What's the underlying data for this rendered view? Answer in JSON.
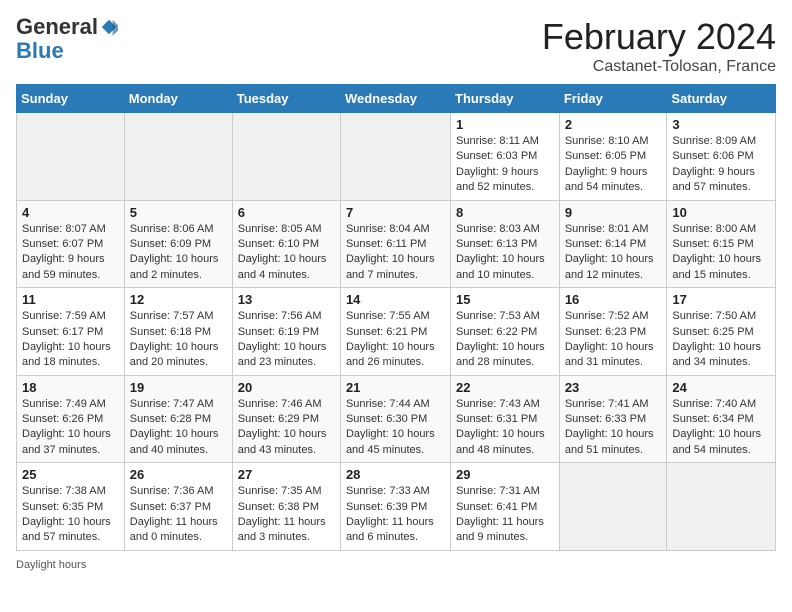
{
  "header": {
    "logo_general": "General",
    "logo_blue": "Blue",
    "main_title": "February 2024",
    "subtitle": "Castanet-Tolosan, France"
  },
  "days_of_week": [
    "Sunday",
    "Monday",
    "Tuesday",
    "Wednesday",
    "Thursday",
    "Friday",
    "Saturday"
  ],
  "footer": {
    "note": "Daylight hours"
  },
  "weeks": [
    {
      "days": [
        {
          "number": "",
          "info": "",
          "empty": true
        },
        {
          "number": "",
          "info": "",
          "empty": true
        },
        {
          "number": "",
          "info": "",
          "empty": true
        },
        {
          "number": "",
          "info": "",
          "empty": true
        },
        {
          "number": "1",
          "info": "Sunrise: 8:11 AM\nSunset: 6:03 PM\nDaylight: 9 hours and 52 minutes."
        },
        {
          "number": "2",
          "info": "Sunrise: 8:10 AM\nSunset: 6:05 PM\nDaylight: 9 hours and 54 minutes."
        },
        {
          "number": "3",
          "info": "Sunrise: 8:09 AM\nSunset: 6:06 PM\nDaylight: 9 hours and 57 minutes."
        }
      ]
    },
    {
      "days": [
        {
          "number": "4",
          "info": "Sunrise: 8:07 AM\nSunset: 6:07 PM\nDaylight: 9 hours and 59 minutes."
        },
        {
          "number": "5",
          "info": "Sunrise: 8:06 AM\nSunset: 6:09 PM\nDaylight: 10 hours and 2 minutes."
        },
        {
          "number": "6",
          "info": "Sunrise: 8:05 AM\nSunset: 6:10 PM\nDaylight: 10 hours and 4 minutes."
        },
        {
          "number": "7",
          "info": "Sunrise: 8:04 AM\nSunset: 6:11 PM\nDaylight: 10 hours and 7 minutes."
        },
        {
          "number": "8",
          "info": "Sunrise: 8:03 AM\nSunset: 6:13 PM\nDaylight: 10 hours and 10 minutes."
        },
        {
          "number": "9",
          "info": "Sunrise: 8:01 AM\nSunset: 6:14 PM\nDaylight: 10 hours and 12 minutes."
        },
        {
          "number": "10",
          "info": "Sunrise: 8:00 AM\nSunset: 6:15 PM\nDaylight: 10 hours and 15 minutes."
        }
      ]
    },
    {
      "days": [
        {
          "number": "11",
          "info": "Sunrise: 7:59 AM\nSunset: 6:17 PM\nDaylight: 10 hours and 18 minutes."
        },
        {
          "number": "12",
          "info": "Sunrise: 7:57 AM\nSunset: 6:18 PM\nDaylight: 10 hours and 20 minutes."
        },
        {
          "number": "13",
          "info": "Sunrise: 7:56 AM\nSunset: 6:19 PM\nDaylight: 10 hours and 23 minutes."
        },
        {
          "number": "14",
          "info": "Sunrise: 7:55 AM\nSunset: 6:21 PM\nDaylight: 10 hours and 26 minutes."
        },
        {
          "number": "15",
          "info": "Sunrise: 7:53 AM\nSunset: 6:22 PM\nDaylight: 10 hours and 28 minutes."
        },
        {
          "number": "16",
          "info": "Sunrise: 7:52 AM\nSunset: 6:23 PM\nDaylight: 10 hours and 31 minutes."
        },
        {
          "number": "17",
          "info": "Sunrise: 7:50 AM\nSunset: 6:25 PM\nDaylight: 10 hours and 34 minutes."
        }
      ]
    },
    {
      "days": [
        {
          "number": "18",
          "info": "Sunrise: 7:49 AM\nSunset: 6:26 PM\nDaylight: 10 hours and 37 minutes."
        },
        {
          "number": "19",
          "info": "Sunrise: 7:47 AM\nSunset: 6:28 PM\nDaylight: 10 hours and 40 minutes."
        },
        {
          "number": "20",
          "info": "Sunrise: 7:46 AM\nSunset: 6:29 PM\nDaylight: 10 hours and 43 minutes."
        },
        {
          "number": "21",
          "info": "Sunrise: 7:44 AM\nSunset: 6:30 PM\nDaylight: 10 hours and 45 minutes."
        },
        {
          "number": "22",
          "info": "Sunrise: 7:43 AM\nSunset: 6:31 PM\nDaylight: 10 hours and 48 minutes."
        },
        {
          "number": "23",
          "info": "Sunrise: 7:41 AM\nSunset: 6:33 PM\nDaylight: 10 hours and 51 minutes."
        },
        {
          "number": "24",
          "info": "Sunrise: 7:40 AM\nSunset: 6:34 PM\nDaylight: 10 hours and 54 minutes."
        }
      ]
    },
    {
      "days": [
        {
          "number": "25",
          "info": "Sunrise: 7:38 AM\nSunset: 6:35 PM\nDaylight: 10 hours and 57 minutes."
        },
        {
          "number": "26",
          "info": "Sunrise: 7:36 AM\nSunset: 6:37 PM\nDaylight: 11 hours and 0 minutes."
        },
        {
          "number": "27",
          "info": "Sunrise: 7:35 AM\nSunset: 6:38 PM\nDaylight: 11 hours and 3 minutes."
        },
        {
          "number": "28",
          "info": "Sunrise: 7:33 AM\nSunset: 6:39 PM\nDaylight: 11 hours and 6 minutes."
        },
        {
          "number": "29",
          "info": "Sunrise: 7:31 AM\nSunset: 6:41 PM\nDaylight: 11 hours and 9 minutes."
        },
        {
          "number": "",
          "info": "",
          "empty": true
        },
        {
          "number": "",
          "info": "",
          "empty": true
        }
      ]
    }
  ]
}
